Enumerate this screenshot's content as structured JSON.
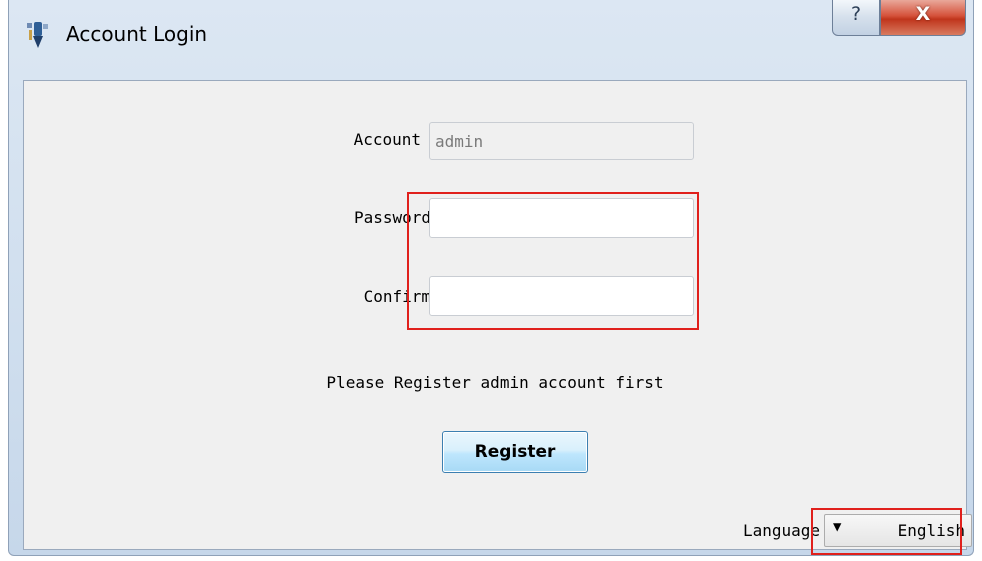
{
  "window": {
    "title": "Account Login",
    "help_label": "?",
    "close_label": "X"
  },
  "form": {
    "account_label": "Account",
    "account_value": "admin",
    "password_label": "Password",
    "password_value": "",
    "confirm_label": "Confirm",
    "confirm_value": ""
  },
  "hint": "Please Register admin account first",
  "register_label": "Register",
  "language": {
    "label": "Language",
    "selected": "English"
  },
  "icons": {
    "app": "app-logo-icon",
    "dropdown": "triangle-down-icon"
  },
  "colors": {
    "highlight": "#e0201c"
  }
}
